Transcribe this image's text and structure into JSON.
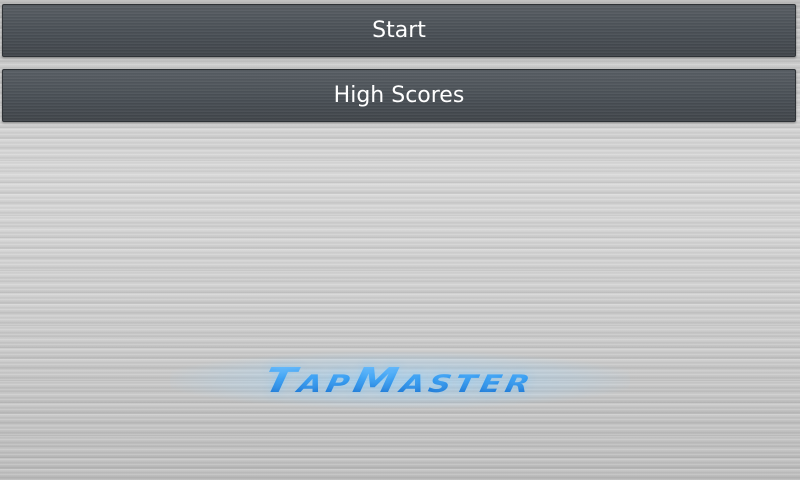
{
  "menu": {
    "start_label": "Start",
    "high_scores_label": "High Scores"
  },
  "logo": {
    "text": "TapMaster"
  },
  "colors": {
    "button_bg": "#4a5056",
    "button_text": "#ffffff",
    "logo_blue": "#1f8be6",
    "background_metal": "#c9c9c9"
  }
}
